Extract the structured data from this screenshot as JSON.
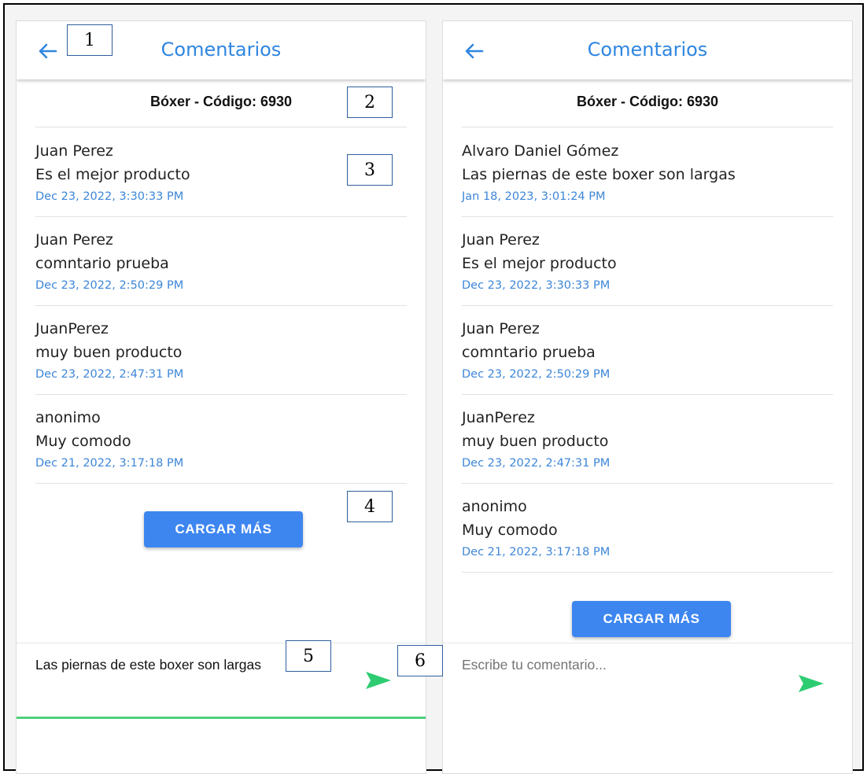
{
  "panels": [
    {
      "app_bar": {
        "title": "Comentarios"
      },
      "product_title": "Bóxer - Código: 6930",
      "comments": [
        {
          "user": "Juan Perez",
          "text": "Es el mejor producto",
          "date": "Dec 23, 2022, 3:30:33 PM"
        },
        {
          "user": "Juan Perez",
          "text": "comntario prueba",
          "date": "Dec 23, 2022, 2:50:29 PM"
        },
        {
          "user": "JuanPerez",
          "text": "muy buen producto",
          "date": "Dec 23, 2022, 2:47:31 PM"
        },
        {
          "user": "anonimo",
          "text": "Muy comodo",
          "date": "Dec 21, 2022, 3:17:18 PM"
        }
      ],
      "load_more_label": "CARGAR MÁS",
      "input": {
        "value": "Las piernas de este boxer son largas",
        "placeholder": ""
      }
    },
    {
      "app_bar": {
        "title": "Comentarios"
      },
      "product_title": "Bóxer - Código: 6930",
      "comments": [
        {
          "user": "Alvaro Daniel Gómez",
          "text": "Las piernas de este boxer son largas",
          "date": "Jan 18, 2023, 3:01:24 PM"
        },
        {
          "user": "Juan Perez",
          "text": "Es el mejor producto",
          "date": "Dec 23, 2022, 3:30:33 PM"
        },
        {
          "user": "Juan Perez",
          "text": "comntario prueba",
          "date": "Dec 23, 2022, 2:50:29 PM"
        },
        {
          "user": "JuanPerez",
          "text": "muy buen producto",
          "date": "Dec 23, 2022, 2:47:31 PM"
        },
        {
          "user": "anonimo",
          "text": "Muy comodo",
          "date": "Dec 21, 2022, 3:17:18 PM"
        }
      ],
      "load_more_label": "CARGAR MÁS",
      "input": {
        "value": "",
        "placeholder": "Escribe tu comentario..."
      }
    }
  ],
  "icons": {
    "back": "arrow-left-icon",
    "send": "send-icon"
  },
  "colors": {
    "accent_blue": "#2f86e0",
    "button_blue": "#3d86f0",
    "send_green": "#2ecc71",
    "date_blue": "#3d86d8"
  },
  "callouts": [
    "1",
    "2",
    "3",
    "4",
    "5",
    "6"
  ]
}
